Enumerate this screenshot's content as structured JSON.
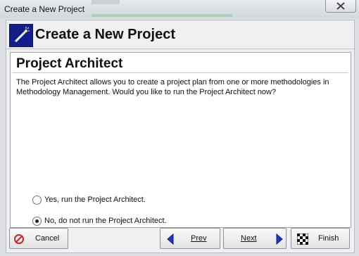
{
  "window": {
    "title": "Create a New Project"
  },
  "header": {
    "title": "Create a New Project"
  },
  "panel": {
    "title": "Project Architect",
    "description": "The Project Architect allows you to create a project plan from one or more methodologies in Methodology Management.  Would you like to run the Project Architect now?"
  },
  "options": [
    {
      "label": "Yes, run the Project Architect.",
      "selected": false
    },
    {
      "label": "No, do not run the Project Architect.",
      "selected": true
    }
  ],
  "buttons": {
    "cancel": "Cancel",
    "prev": "Prev",
    "next": "Next",
    "finish": "Finish"
  },
  "icons": {
    "cancel": "no-entry-icon",
    "prev": "left-arrow-icon",
    "next": "right-arrow-icon",
    "finish": "checkered-flag-icon",
    "header": "magic-wand-icon",
    "close": "close-icon"
  },
  "colors": {
    "accent_blue": "#121f8a",
    "cancel_red": "#c62828",
    "arrow_blue": "#1f35c4"
  }
}
